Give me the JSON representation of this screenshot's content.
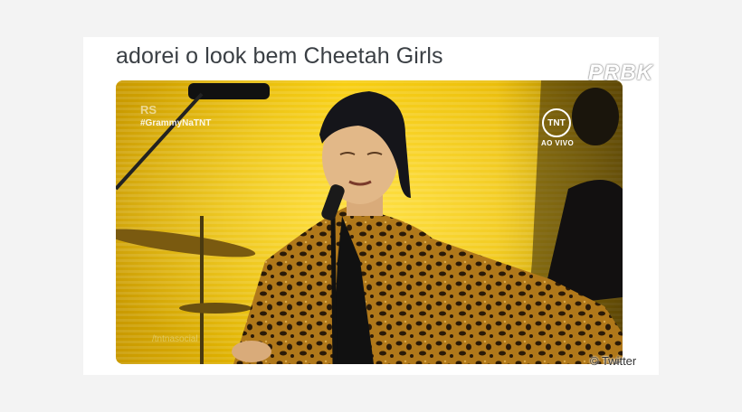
{
  "tweet": {
    "text": "adorei o look bem Cheetah Girls"
  },
  "media": {
    "broadcast": {
      "hashtag": "#GrammyNaTNT",
      "rs_logo": "RS",
      "channel_logo": "TNT",
      "live_label": "AO VIVO",
      "social_handle": "/tntnasocial"
    }
  },
  "watermark": "PRBK",
  "credit": "© Twitter",
  "colors": {
    "page_bg": "#f3f3f3",
    "card_bg": "#ffffff",
    "stage_yellow": "#f2c400",
    "text": "#3a3f44"
  }
}
